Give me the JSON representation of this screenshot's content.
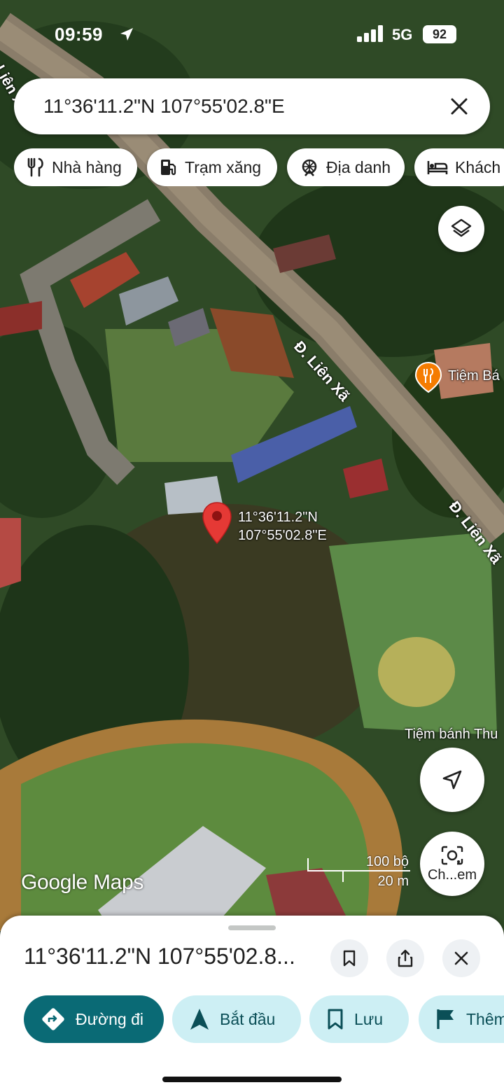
{
  "status_bar": {
    "time": "09:59",
    "network": "5G",
    "battery": "92"
  },
  "search": {
    "query": "11°36'11.2\"N 107°55'02.8\"E"
  },
  "chips": [
    {
      "label": "Nhà hàng",
      "icon": "restaurant-icon"
    },
    {
      "label": "Trạm xăng",
      "icon": "gas-station-icon"
    },
    {
      "label": "Địa danh",
      "icon": "landmark-icon"
    },
    {
      "label": "Khách",
      "icon": "hotel-icon"
    }
  ],
  "map": {
    "road_labels": [
      "Đ. Liên Xã",
      "Đ. Liên Xã",
      "Đ. Liên Xã"
    ],
    "places": {
      "restaurant": "Tiệm Bá",
      "bakery": "Tiệm bánh Thu"
    },
    "pin_label": {
      "line1": "11°36'11.2\"N",
      "line2": "107°55'02.8\"E"
    },
    "logo": "Google Maps",
    "scale": {
      "top": "100 bộ",
      "bottom": "20 m"
    },
    "lens_label": "Ch...em"
  },
  "sheet": {
    "title": "11°36'11.2\"N 107°55'02.8...",
    "actions": [
      {
        "label": "Đường đi",
        "icon": "directions-icon"
      },
      {
        "label": "Bắt đầu",
        "icon": "navigation-arrow-icon"
      },
      {
        "label": "Lưu",
        "icon": "bookmark-icon"
      },
      {
        "label": "Thêm",
        "icon": "flag-icon"
      }
    ]
  },
  "colors": {
    "directions_bg": "#0a6a75",
    "action_bg": "#cdeff4",
    "pin_red": "#e53935",
    "restaurant_orange": "#f57c00"
  }
}
